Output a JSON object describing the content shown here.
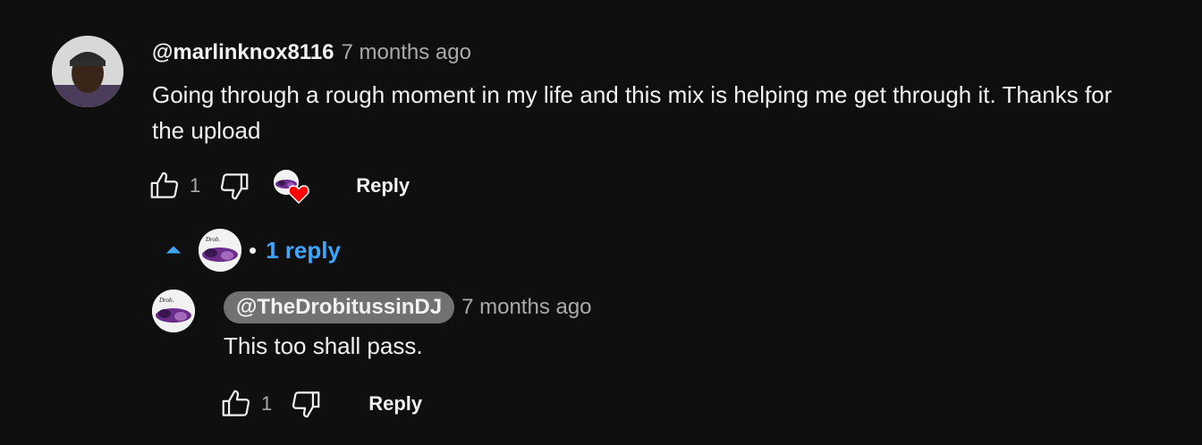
{
  "comment": {
    "author": "@marlinknox8116",
    "time": "7 months ago",
    "text": "Going through a rough moment in my life and this mix is helping me get through it. Thanks for the upload",
    "likes": "1",
    "reply_label": "Reply",
    "hearted": true
  },
  "replies_toggle": {
    "label": "1 reply",
    "separator": "•",
    "expanded": true
  },
  "reply": {
    "author": "@TheDrobitussinDJ",
    "time": "7 months ago",
    "text": "This too shall pass.",
    "likes": "1",
    "reply_label": "Reply"
  },
  "colors": {
    "background": "#0f0f0f",
    "accent": "#3ea6ff",
    "heart": "#ff0000",
    "author_pill": "#717171"
  }
}
